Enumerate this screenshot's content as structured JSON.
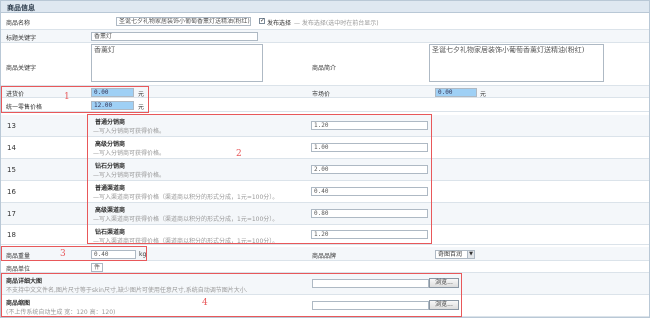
{
  "header": {
    "title": "商品信息"
  },
  "fields": {
    "name_label": "商品名称",
    "name_value": "圣诞七夕礼物家居装饰小葡萄香薰灯送精油(粉红)",
    "publish_label": "发布选择",
    "publish_hint": "— 发布选择(选中时在前台显示)",
    "keyword_title_label": "标题关键字",
    "keyword_title_value": "香薰灯",
    "keywords_label": "商品关键字",
    "keywords_value": "香薰灯",
    "intro_label": "商品简介",
    "intro_value": "圣诞七夕礼物家居装饰小葡萄香薰灯送精油(粉红)",
    "purchase_label": "进货价",
    "purchase_value": "0.00",
    "purchase_unit": "元",
    "market_label": "市场价",
    "market_value": "0.00",
    "market_unit": "元",
    "retail_label": "统一零售价格",
    "retail_value": "12.00",
    "retail_unit": "元",
    "weight_label": "商品重量",
    "weight_value": "0.40",
    "weight_unit": "kg",
    "brand_label": "商品品牌",
    "brand_value": "奇图百润",
    "unit_label": "商品单位",
    "unit_value": "件",
    "bigimg_label": "商品详细大图",
    "bigimg_hint": "不支持中文文件名,图片尺寸等于skin尺寸,缺少图片可使用任意尺寸,系统自动调节图片大小.",
    "thumb_label": "商品缩图",
    "thumb_hint": "(不上传系统自动生成 宽：120 高：120)",
    "browse_label": "浏览..."
  },
  "tiers": [
    {
      "id": "13",
      "name": "普通分销商",
      "hint": "—写入分销商可获得价格。",
      "value": "1.20"
    },
    {
      "id": "14",
      "name": "高级分销商",
      "hint": "—写入分销商可获得价格。",
      "value": "1.00"
    },
    {
      "id": "15",
      "name": "钻石分销商",
      "hint": "—写入分销商可获得价格。",
      "value": "2.00"
    },
    {
      "id": "16",
      "name": "普通渠道商",
      "hint": "—写入渠道商可获得价格（渠道商以积分的形式分成，1元=100分）。",
      "value": "0.40"
    },
    {
      "id": "17",
      "name": "高级渠道商",
      "hint": "—写入渠道商可获得价格（渠道商以积分的形式分成，1元=100分）。",
      "value": "0.80"
    },
    {
      "id": "18",
      "name": "钻石渠道商",
      "hint": "—写入渠道商可获得价格（渠道商以积分的形式分成，1元=100分）。",
      "value": "1.20"
    }
  ],
  "callouts": {
    "c1": "1",
    "c2": "2",
    "c3": "3",
    "c4": "4"
  },
  "colors": {
    "accent_red": "#e8585a",
    "header_bg": "#dfe8f1",
    "highlight_input": "#9fd0f5"
  }
}
